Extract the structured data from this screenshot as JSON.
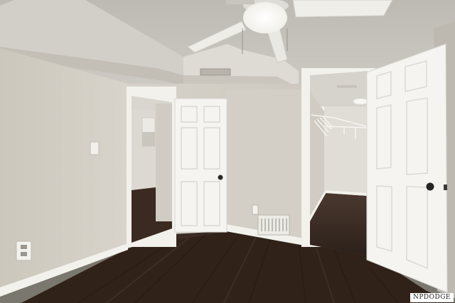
{
  "scene": {
    "description_label": "",
    "colors": {
      "wall": "#d7d3ca",
      "ceiling": "#c9c6bf",
      "trim": "#f4f3ef",
      "floor_dark": "#2a1f1a",
      "floor_mid": "#3b2c25",
      "door": "#f5f4f1"
    }
  },
  "watermark": {
    "text": "NPDODGE"
  }
}
